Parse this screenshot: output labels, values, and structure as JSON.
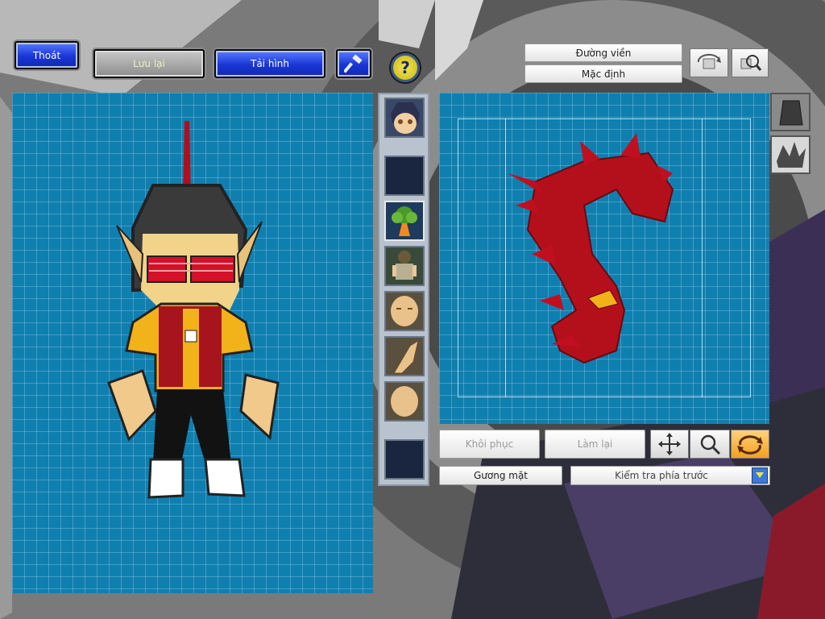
{
  "toolbar": {
    "exit_label": "Thoát",
    "save_label": "Lưu lại",
    "reload_label": "Tải hình",
    "help_symbol": "?"
  },
  "right_top": {
    "outline_label": "Đường viền",
    "default_label": "Mặc định"
  },
  "controls": {
    "restore_label": "Khôi phục",
    "redo_label": "Làm lại"
  },
  "bottom": {
    "mirror_label": "Gương mặt",
    "view_select_value": "Kiểm tra phía trước"
  },
  "parts_strip": {
    "slots": [
      {
        "icon": "face-portrait-icon"
      },
      {
        "icon": "empty-slot"
      },
      {
        "icon": "hair-tree-icon"
      },
      {
        "icon": "body-outfit-icon"
      },
      {
        "icon": "face-shape-icon"
      },
      {
        "icon": "ear-icon"
      },
      {
        "icon": "face-blank-icon"
      },
      {
        "icon": "empty-slot"
      }
    ]
  },
  "colors": {
    "grid_panel": "#0f7fb0",
    "button_blue": "#1836d6",
    "hair_red": "#b4101c",
    "accent_gold": "#f2b21a"
  }
}
